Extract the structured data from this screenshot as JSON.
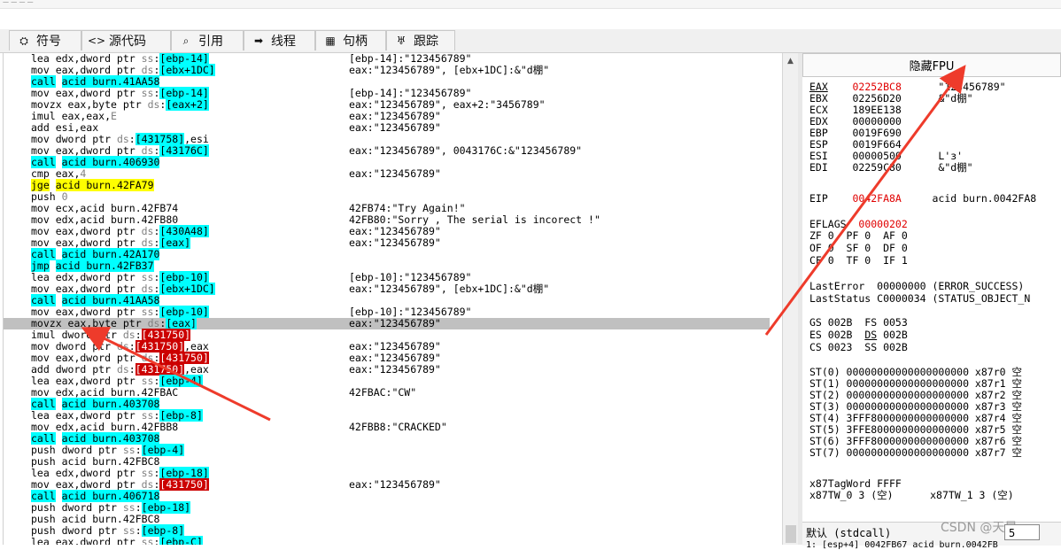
{
  "window": {
    "title_fragment": "— — — —"
  },
  "tabs": [
    {
      "label": "符号",
      "icon": "symbol-icon"
    },
    {
      "label": "源代码",
      "icon": "source-code-icon"
    },
    {
      "label": "引用",
      "icon": "search-icon"
    },
    {
      "label": "线程",
      "icon": "thread-icon"
    },
    {
      "label": "句柄",
      "icon": "handle-icon"
    },
    {
      "label": "跟踪",
      "icon": "trace-icon"
    }
  ],
  "disasm": [
    {
      "ins": "lea edx,dword ptr ss:[ebp-14]",
      "cmt": "[ebp-14]:\"123456789\""
    },
    {
      "ins": "mov eax,dword ptr ds:[ebx+1DC]",
      "cmt": "eax:\"123456789\", [ebx+1DC]:&\"d棚\""
    },
    {
      "ins": "call acid burn.41AA58",
      "cmt": ""
    },
    {
      "ins": "mov eax,dword ptr ss:[ebp-14]",
      "cmt": "[ebp-14]:\"123456789\""
    },
    {
      "ins": "movzx eax,byte ptr ds:[eax+2]",
      "cmt": "eax:\"123456789\", eax+2:\"3456789\""
    },
    {
      "ins": "imul eax,eax,E",
      "cmt": "eax:\"123456789\""
    },
    {
      "ins": "add esi,eax",
      "cmt": "eax:\"123456789\""
    },
    {
      "ins": "mov dword ptr ds:[431758],esi",
      "cmt": ""
    },
    {
      "ins": "mov eax,dword ptr ds:[43176C]",
      "cmt": "eax:\"123456789\", 0043176C:&\"123456789\""
    },
    {
      "ins": "call acid burn.406930",
      "cmt": ""
    },
    {
      "ins": "cmp eax,4",
      "cmt": "eax:\"123456789\""
    },
    {
      "ins": "jge acid burn.42FA79",
      "cmt": ""
    },
    {
      "ins": "push 0",
      "cmt": ""
    },
    {
      "ins": "mov ecx,acid burn.42FB74",
      "cmt": "42FB74:\"Try Again!\""
    },
    {
      "ins": "mov edx,acid burn.42FB80",
      "cmt": "42FB80:\"Sorry , The serial is incorect !\""
    },
    {
      "ins": "mov eax,dword ptr ds:[430A48]",
      "cmt": "eax:\"123456789\""
    },
    {
      "ins": "mov eax,dword ptr ds:[eax]",
      "cmt": "eax:\"123456789\""
    },
    {
      "ins": "call acid burn.42A170",
      "cmt": ""
    },
    {
      "ins": "jmp acid burn.42FB37",
      "cmt": ""
    },
    {
      "ins": "lea edx,dword ptr ss:[ebp-10]",
      "cmt": "[ebp-10]:\"123456789\""
    },
    {
      "ins": "mov eax,dword ptr ds:[ebx+1DC]",
      "cmt": "eax:\"123456789\", [ebx+1DC]:&\"d棚\""
    },
    {
      "ins": "call acid burn.41AA58",
      "cmt": ""
    },
    {
      "ins": "mov eax,dword ptr ss:[ebp-10]",
      "cmt": "[ebp-10]:\"123456789\""
    },
    {
      "ins": "movzx eax,byte ptr ds:[eax]",
      "cmt": "eax:\"123456789\""
    },
    {
      "ins": "imul dword ptr ds:[431750]",
      "cmt": ""
    },
    {
      "ins": "mov dword ptr ds:[431750],eax",
      "cmt": "eax:\"123456789\""
    },
    {
      "ins": "mov eax,dword ptr ds:[431750]",
      "cmt": "eax:\"123456789\""
    },
    {
      "ins": "add dword ptr ds:[431750],eax",
      "cmt": "eax:\"123456789\""
    },
    {
      "ins": "lea eax,dword ptr ss:[ebp-4]",
      "cmt": ""
    },
    {
      "ins": "mov edx,acid burn.42FBAC",
      "cmt": "42FBAC:\"CW\""
    },
    {
      "ins": "call acid burn.403708",
      "cmt": ""
    },
    {
      "ins": "lea eax,dword ptr ss:[ebp-8]",
      "cmt": ""
    },
    {
      "ins": "mov edx,acid burn.42FBB8",
      "cmt": "42FBB8:\"CRACKED\""
    },
    {
      "ins": "call acid burn.403708",
      "cmt": ""
    },
    {
      "ins": "push dword ptr ss:[ebp-4]",
      "cmt": ""
    },
    {
      "ins": "push acid burn.42FBC8",
      "cmt": ""
    },
    {
      "ins": "lea edx,dword ptr ss:[ebp-18]",
      "cmt": ""
    },
    {
      "ins": "mov eax,dword ptr ds:[431750]",
      "cmt": "eax:\"123456789\""
    },
    {
      "ins": "call acid burn.406718",
      "cmt": ""
    },
    {
      "ins": "push dword ptr ss:[ebp-18]",
      "cmt": ""
    },
    {
      "ins": "push acid burn.42FBC8",
      "cmt": ""
    },
    {
      "ins": "push dword ptr ss:[ebp-8]",
      "cmt": ""
    },
    {
      "ins": "lea eax,dword ptr ss:[ebp-C]",
      "cmt": ""
    }
  ],
  "highlighted_row": 23,
  "fpu": {
    "header": "隐藏FPU",
    "registers": [
      {
        "name": "EAX",
        "value": "02252BC8",
        "info": "\"123456789\"",
        "changed": true
      },
      {
        "name": "EBX",
        "value": "02256D20",
        "info": "&\"d棚\"",
        "changed": false
      },
      {
        "name": "ECX",
        "value": "189EE138",
        "info": "",
        "changed": false
      },
      {
        "name": "EDX",
        "value": "00000000",
        "info": "",
        "changed": false
      },
      {
        "name": "EBP",
        "value": "0019F690",
        "info": "",
        "changed": false
      },
      {
        "name": "ESP",
        "value": "0019F664",
        "info": "",
        "changed": false
      },
      {
        "name": "ESI",
        "value": "00000500",
        "info": "L'ɜ'",
        "changed": false
      },
      {
        "name": "EDI",
        "value": "02259C80",
        "info": "&\"d棚\"",
        "changed": false
      }
    ],
    "eip": {
      "name": "EIP",
      "value": "0042FA8A",
      "info": "acid burn.0042FA8"
    },
    "eflags": {
      "name": "EFLAGS",
      "value": "00000202"
    },
    "flags_rows": [
      "ZF 0  PF 0  AF 0",
      "OF 0  SF 0  DF 0",
      "CF 0  TF 0  IF 1"
    ],
    "last_error": "LastError  00000000 (ERROR_SUCCESS)",
    "last_status": "LastStatus C0000034 (STATUS_OBJECT_N",
    "seg_rows": [
      {
        "a": "GS 002B",
        "b_name": "FS",
        "b_val": "0053"
      },
      {
        "a": "ES 002B",
        "b_name": "DS",
        "b_val": "002B"
      },
      {
        "a": "CS 0023",
        "b_name": "SS",
        "b_val": "002B"
      }
    ],
    "st_rows": [
      "ST(0) 00000000000000000000 x87r0 空",
      "ST(1) 00000000000000000000 x87r1 空",
      "ST(2) 00000000000000000000 x87r2 空",
      "ST(3) 00000000000000000000 x87r3 空",
      "ST(4) 3FFF8000000000000000 x87r4 空",
      "ST(5) 3FFE8000000000000000 x87r5 空",
      "ST(6) 3FFF8000000000000000 x87r6 空",
      "ST(7) 00000000000000000000 x87r7 空"
    ],
    "tagword": "x87TagWord FFFF",
    "tw_row": "x87TW_0 3 (空)      x87TW_1 3 (空)"
  },
  "status": {
    "callconv": "默认 (stdcall)",
    "arg_count": "5",
    "watermark": "CSDN @天晨",
    "bottom_text": "1: [esp+4] 0042FB67 acid burn.0042FB"
  },
  "colors": {
    "arrow": "#ee3b2b",
    "call_bg": "#00ffff",
    "jcc_bg": "#ffff00",
    "mem_red": "#cc0000"
  }
}
